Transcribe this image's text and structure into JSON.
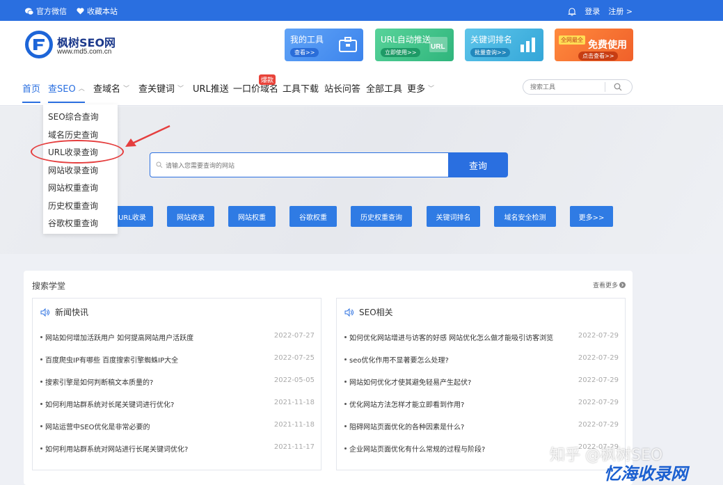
{
  "topbar": {
    "wechat": "官方微信",
    "favorite": "收藏本站",
    "login": "登录",
    "register": "注册 >"
  },
  "logo": {
    "name": "枫树SEO网",
    "domain": "www.md5.com.cn"
  },
  "promos": [
    {
      "title": "我的工具",
      "sub": "查看>>",
      "icon": "toolbox-icon"
    },
    {
      "title": "URL自动推送",
      "sub": "立即使用>>",
      "icon": "url-icon"
    },
    {
      "title": "关键词排名",
      "sub": "批量查询>>",
      "icon": "bar-chart-icon"
    },
    {
      "title": "免费使用",
      "badge": "全网最全",
      "sub": "点击查看>>"
    }
  ],
  "nav": {
    "items": [
      "首页",
      "查SEO",
      "查域名",
      "查关键词",
      "URL推送",
      "一口价域名",
      "工具下载",
      "站长问答",
      "全部工具",
      "更多"
    ],
    "hot": "爆款",
    "search_placeholder": "搜索工具"
  },
  "dropdown": [
    "SEO综合查询",
    "域名历史查询",
    "URL收录查询",
    "网站收录查询",
    "网站权重查询",
    "历史权重查询",
    "谷歌权重查询"
  ],
  "hero": {
    "placeholder": "请输入您需要查询的网站",
    "query_button": "查询",
    "tools": [
      "URL收录",
      "网站收录",
      "网站权重",
      "谷歌权重",
      "历史权重查询",
      "关键词排名",
      "域名安全检测",
      "更多>>"
    ]
  },
  "panel": {
    "title": "搜索学堂",
    "more": "查看更多",
    "news": {
      "title": "新闻快讯",
      "items": [
        {
          "text": "网站如何增加活跃用户 如何提高网站用户活跃度",
          "date": "2022-07-27"
        },
        {
          "text": "百度爬虫IP有哪些 百度搜索引擎蜘蛛IP大全",
          "date": "2022-07-25"
        },
        {
          "text": "搜索引擎是如何判断稿文本质量的?",
          "date": "2022-05-05"
        },
        {
          "text": "如何利用站群系统对长尾关键词进行优化?",
          "date": "2021-11-18"
        },
        {
          "text": "网站运营中SEO优化是非常必要的",
          "date": "2021-11-18"
        },
        {
          "text": "如何利用站群系统对网站进行长尾关键词优化?",
          "date": "2021-11-17"
        }
      ]
    },
    "seo": {
      "title": "SEO相关",
      "items": [
        {
          "text": "如何优化网站增进与访客的好感 网站优化怎么做才能吸引访客浏览",
          "date": "2022-07-29"
        },
        {
          "text": "seo优化作用不显著要怎么处理?",
          "date": "2022-07-29"
        },
        {
          "text": "网站如何优化才使其避免轻易产生起伏?",
          "date": "2022-07-29"
        },
        {
          "text": "优化网站方法怎样才能立即看到作用?",
          "date": "2022-07-29"
        },
        {
          "text": "阻碍网站页面优化的各种因素是什么?",
          "date": "2022-07-29"
        },
        {
          "text": "企业网站页面优化有什么常规的过程与阶段?",
          "date": "2022-07-29"
        }
      ]
    }
  },
  "watermark": {
    "zhihu": "知乎 @枫树SEO",
    "site": "忆海收录网"
  },
  "colors": {
    "primary": "#2a6fe0",
    "highlight": "#e53e3e",
    "hot": "#e8433a"
  }
}
